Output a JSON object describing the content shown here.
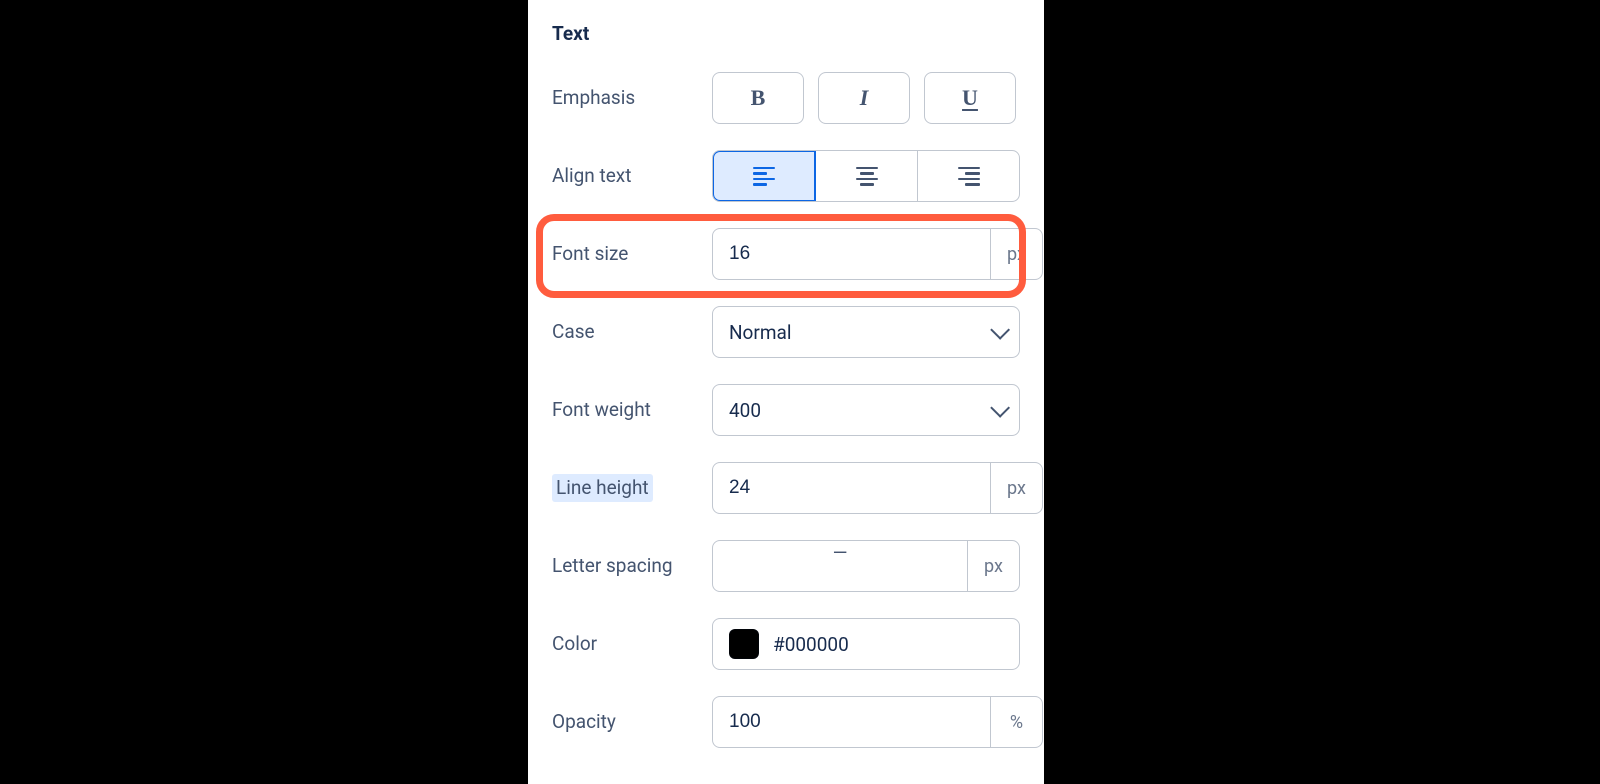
{
  "section_title": "Text",
  "emphasis": {
    "label": "Emphasis",
    "bold": "B",
    "italic": "I",
    "underline": "U"
  },
  "align": {
    "label": "Align text",
    "active": "left"
  },
  "font_size": {
    "label": "Font size",
    "value": "16",
    "unit": "px"
  },
  "case": {
    "label": "Case",
    "value": "Normal"
  },
  "font_weight": {
    "label": "Font weight",
    "value": "400"
  },
  "line_height": {
    "label": "Line height",
    "value": "24",
    "unit": "px"
  },
  "letter_spacing": {
    "label": "Letter spacing",
    "value": "—",
    "unit": "px"
  },
  "color": {
    "label": "Color",
    "value": "#000000",
    "swatch": "#000000"
  },
  "opacity": {
    "label": "Opacity",
    "value": "100",
    "unit": "%"
  }
}
